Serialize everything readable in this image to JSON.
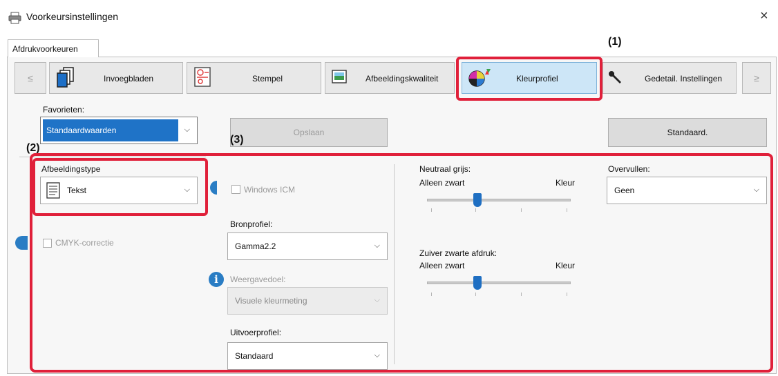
{
  "window": {
    "title": "Voorkeursinstellingen",
    "close_glyph": "×"
  },
  "tab": {
    "label": "Afdrukvoorkeuren"
  },
  "toolbar": {
    "prev": "≤",
    "next": "≥",
    "buttons": [
      {
        "label": "Invoegbladen"
      },
      {
        "label": "Stempel"
      },
      {
        "label": "Afbeeldingskwaliteit"
      },
      {
        "label": "Kleurprofiel"
      },
      {
        "label": "Gedetail. Instellingen"
      }
    ]
  },
  "favorites": {
    "label": "Favorieten:",
    "value": "Standaardwaarden",
    "save_label": "Opslaan",
    "default_label": "Standaard."
  },
  "image_type": {
    "label": "Afbeeldingstype",
    "value": "Tekst"
  },
  "cmyk": {
    "label": "CMYK-correctie"
  },
  "windows_icm": {
    "label": "Windows ICM"
  },
  "source_profile": {
    "label": "Bronprofiel:",
    "value": "Gamma2.2"
  },
  "rendering_intent": {
    "label": "Weergavedoel:",
    "value": "Visuele kleurmeting"
  },
  "output_profile": {
    "label": "Uitvoerprofiel:",
    "value": "Standaard"
  },
  "neutral_gray": {
    "label": "Neutraal grijs:",
    "left": "Alleen zwart",
    "right": "Kleur",
    "level": 0.35
  },
  "pure_black": {
    "label": "Zuiver zwarte afdruk:",
    "left": "Alleen zwart",
    "right": "Kleur",
    "level": 0.35
  },
  "overfill": {
    "label": "Overvullen:",
    "value": "Geen"
  },
  "callouts": {
    "c1": "(1)",
    "c2": "(2)",
    "c3": "(3)"
  },
  "colors": {
    "highlight": "#e0203a",
    "active_tab": "#cde6f7",
    "slider_thumb": "#1f6fc2"
  }
}
